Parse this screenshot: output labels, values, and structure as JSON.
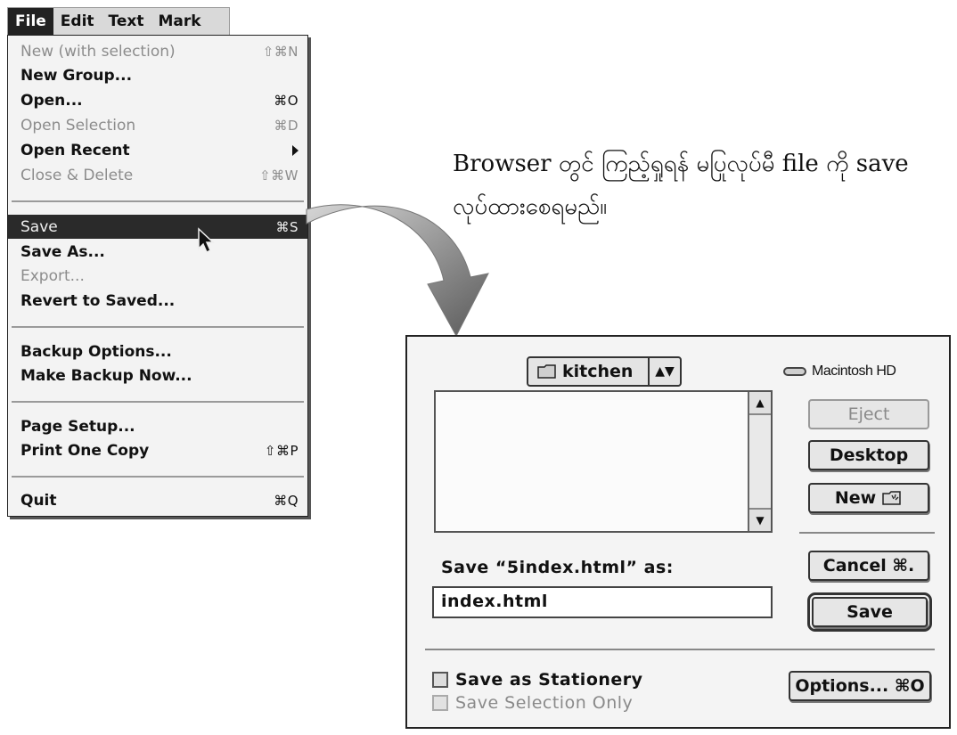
{
  "menubar": {
    "items": [
      "File",
      "Edit",
      "Text",
      "Mark"
    ],
    "active": "File"
  },
  "file_menu": {
    "items": [
      {
        "label": "New (with selection)",
        "shortcut": "⇧⌘N",
        "enabled": false
      },
      {
        "label": "New Group...",
        "shortcut": "",
        "enabled": true
      },
      {
        "label": "Open...",
        "shortcut": "⌘O",
        "enabled": true
      },
      {
        "label": "Open Selection",
        "shortcut": "⌘D",
        "enabled": false
      },
      {
        "label": "Open Recent",
        "shortcut": "",
        "enabled": true,
        "submenu": true
      },
      {
        "label": "Close & Delete",
        "shortcut": "⇧⌘W",
        "enabled": false
      },
      {
        "label": "Save",
        "shortcut": "⌘S",
        "enabled": true,
        "selected": true
      },
      {
        "label": "Save As...",
        "shortcut": "",
        "enabled": true
      },
      {
        "label": "Export...",
        "shortcut": "",
        "enabled": false
      },
      {
        "label": "Revert to Saved...",
        "shortcut": "",
        "enabled": true
      },
      {
        "label": "Backup Options...",
        "shortcut": "",
        "enabled": true
      },
      {
        "label": "Make Backup Now...",
        "shortcut": "",
        "enabled": true
      },
      {
        "label": "Page Setup...",
        "shortcut": "",
        "enabled": true
      },
      {
        "label": "Print One Copy",
        "shortcut": "⇧⌘P",
        "enabled": true
      },
      {
        "label": "Quit",
        "shortcut": "⌘Q",
        "enabled": true
      }
    ]
  },
  "caption": {
    "line1": "Browser တွင် ကြည့်ရှုရန် မပြုလုပ်မီ file ကို save",
    "line2": "လုပ်ထားစေရမည်။"
  },
  "save_dialog": {
    "folder_popup": "kitchen",
    "volume": "Macintosh HD",
    "buttons": {
      "eject": "Eject",
      "desktop": "Desktop",
      "new_folder": "New",
      "cancel": "Cancel ⌘.",
      "save": "Save",
      "options": "Options... ⌘O"
    },
    "prompt": "Save “5index.html” as:",
    "filename": "index.html",
    "checkboxes": {
      "stationery": "Save as Stationery",
      "selection_only": "Save Selection Only"
    }
  }
}
